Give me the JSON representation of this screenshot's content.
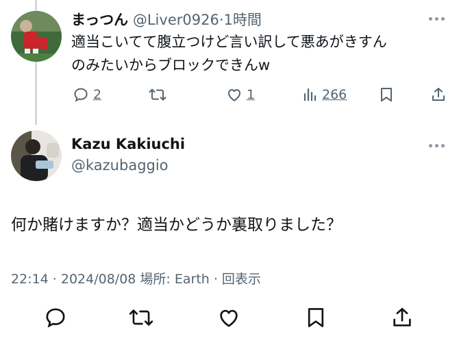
{
  "reply": {
    "display_name": "まっつん",
    "handle": "@Liver0926",
    "separator": "·",
    "time": "1時間",
    "text_line1": "適当こいてて腹立つけど言い訳して悪あがきすん",
    "text_line2": "のみたいからブロックできんw",
    "stats": {
      "replies": "2",
      "likes": "1",
      "views": "266"
    },
    "icons": [
      "reply-icon",
      "retweet-icon",
      "like-icon",
      "views-icon",
      "bookmark-icon",
      "share-icon",
      "more-icon"
    ]
  },
  "tweet": {
    "display_name": "Kazu Kakiuchi",
    "handle": "@kazubaggio",
    "text": "何か賭けますか？適当かどうか裏取りました？",
    "meta": "22:14 · 2024/08/08 場所: Earth · 回表示",
    "icons": [
      "reply-icon",
      "retweet-icon",
      "like-icon",
      "bookmark-icon",
      "share-icon",
      "more-icon"
    ]
  },
  "colors": {
    "text": "#0f1419",
    "muted": "#536471",
    "thread_line": "#cfd9de",
    "background": "#ffffff"
  }
}
